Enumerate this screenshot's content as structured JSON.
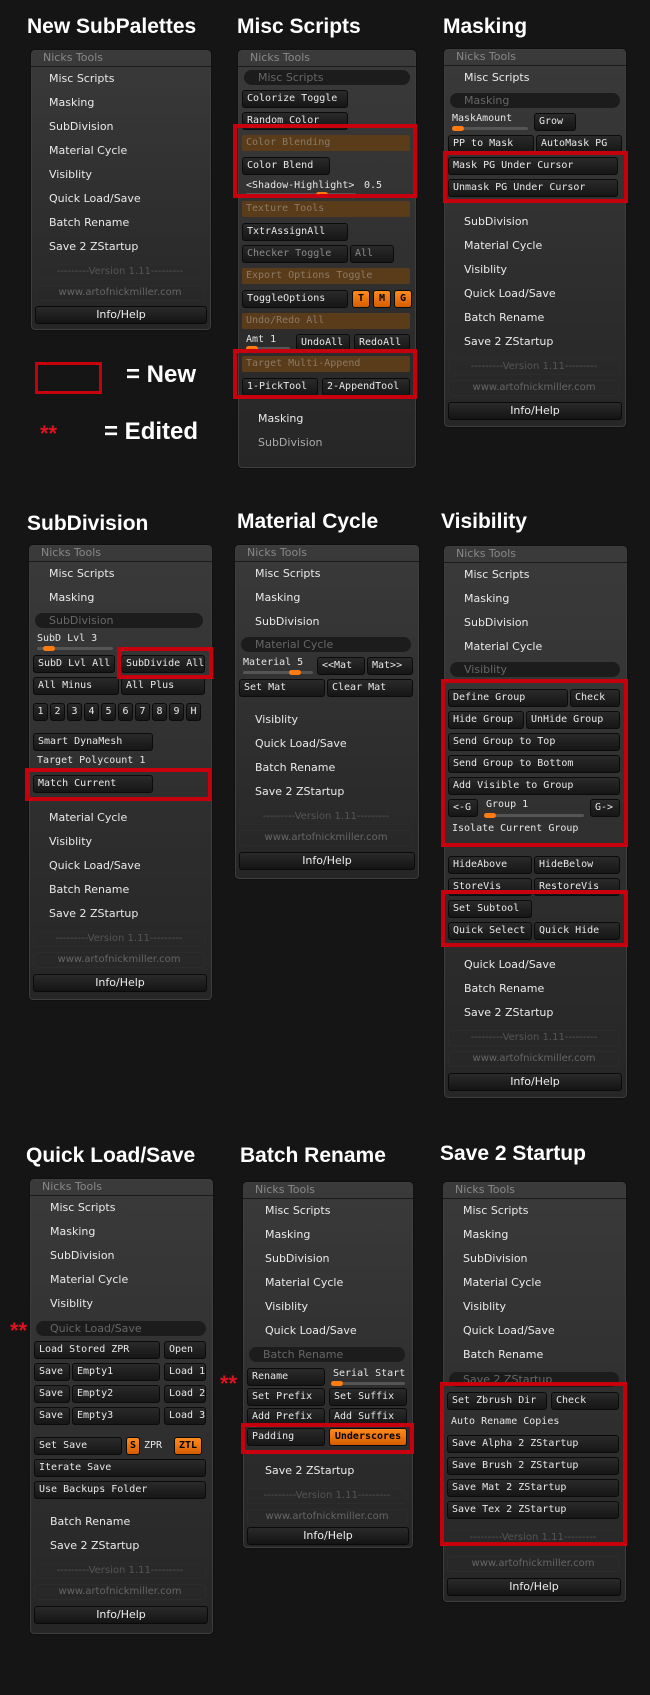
{
  "headings": {
    "new_subpalettes": "New SubPalettes",
    "misc_scripts": "Misc Scripts",
    "masking": "Masking",
    "subdivision": "SubDivision",
    "material_cycle": "Material Cycle",
    "visibility": "Visibility",
    "quick_load_save": "Quick Load/Save",
    "batch_rename": "Batch Rename",
    "save_2_startup": "Save 2 Startup"
  },
  "common": {
    "panel_title": "Nicks Tools",
    "version": "---------Version 1.11---------",
    "site": "www.artofnickmiller.com",
    "info_help": "Info/Help"
  },
  "menu": {
    "misc_scripts": "Misc Scripts",
    "masking": "Masking",
    "subdivision": "SubDivision",
    "material_cycle": "Material Cycle",
    "visiblity": "Visiblity",
    "quick_load_save": "Quick Load/Save",
    "batch_rename": "Batch Rename",
    "save_2_zstartup": "Save 2 ZStartup"
  },
  "legend": {
    "new": "= New",
    "edited_marker": "**",
    "edited": "= Edited"
  },
  "misc": {
    "colorize_toggle": "Colorize Toggle",
    "random_color": "Random Color",
    "color_blending": "Color Blending",
    "color_blend": "Color Blend",
    "shadow_highlight": "<Shadow-Highlight>",
    "shadow_value": "0.5",
    "texture_tools": "Texture Tools",
    "txtr_assign_all": "TxtrAssignAll",
    "checker_toggle": "Checker Toggle",
    "all": "All",
    "export_options_toggle": "Export Options Toggle",
    "toggle_options": "ToggleOptions",
    "t": "T",
    "m": "M",
    "g": "G",
    "undo_redo_all": "Undo/Redo All",
    "amt": "Amt 1",
    "undo_all": "UndoAll",
    "redo_all": "RedoAll",
    "target_multi_append": "Target Multi-Append",
    "pick_tool": "1-PickTool",
    "append_tool": "2-AppendTool"
  },
  "masking_panel": {
    "mask_amount": "MaskAmount",
    "grow": "Grow",
    "pp_to_mask": "PP to Mask",
    "automask_pg": "AutoMask PG",
    "mask_pg_under_cursor": "Mask PG Under Cursor",
    "unmask_pg_under_cursor": "Unmask PG Under Cursor"
  },
  "subdiv": {
    "subd_lvl": "SubD Lvl 3",
    "subd_lvl_all": "SubD Lvl All",
    "subdivide_all": "SubDivide All",
    "all_minus": "All Minus",
    "all_plus": "All Plus",
    "levels": [
      "1",
      "2",
      "3",
      "4",
      "5",
      "6",
      "7",
      "8",
      "9",
      "H"
    ],
    "smart_dynamesh": "Smart DynaMesh",
    "target_polycount": "Target Polycount 1",
    "match_current": "Match Current"
  },
  "matcycle": {
    "material": "Material 5",
    "prev": "<<Mat",
    "next": "Mat>>",
    "set_mat": "Set Mat",
    "clear_mat": "Clear Mat"
  },
  "visib": {
    "define_group": "Define Group",
    "check": "Check",
    "hide_group": "Hide Group",
    "unhide_group": "UnHide Group",
    "send_top": "Send Group to Top",
    "send_bottom": "Send Group to Bottom",
    "add_visible": "Add Visible to Group",
    "prev_g": "<-G",
    "group": "Group 1",
    "next_g": "G->",
    "isolate": "Isolate Current Group",
    "hide_above": "HideAbove",
    "hide_below": "HideBelow",
    "store_vis": "StoreVis",
    "restore_vis": "RestoreVis",
    "set_subtool": "Set Subtool",
    "quick_select": "Quick Select",
    "quick_hide": "Quick Hide"
  },
  "qls": {
    "load_stored": "Load Stored ZPR",
    "open": "Open",
    "save": "Save",
    "empty1": "Empty1",
    "empty2": "Empty2",
    "empty3": "Empty3",
    "load1": "Load 1",
    "load2": "Load 2",
    "load3": "Load 3",
    "set_save": "Set Save",
    "s": "S",
    "zpr": "ZPR",
    "ztl": "ZTL",
    "iterate_save": "Iterate Save",
    "use_backups": "Use Backups Folder"
  },
  "batch": {
    "rename": "Rename",
    "serial_start": "Serial Start",
    "set_prefix": "Set Prefix",
    "set_suffix": "Set Suffix",
    "add_prefix": "Add Prefix",
    "add_suffix": "Add Suffix",
    "padding": "Padding",
    "underscores": "Underscores"
  },
  "startup": {
    "set_zbrush_dir": "Set Zbrush Dir",
    "check": "Check",
    "auto_rename": "Auto Rename Copies",
    "save_alpha": "Save Alpha 2 ZStartup",
    "save_brush": "Save Brush 2 ZStartup",
    "save_mat": "Save Mat 2 ZStartup",
    "save_tex": "Save Tex 2 ZStartup"
  }
}
